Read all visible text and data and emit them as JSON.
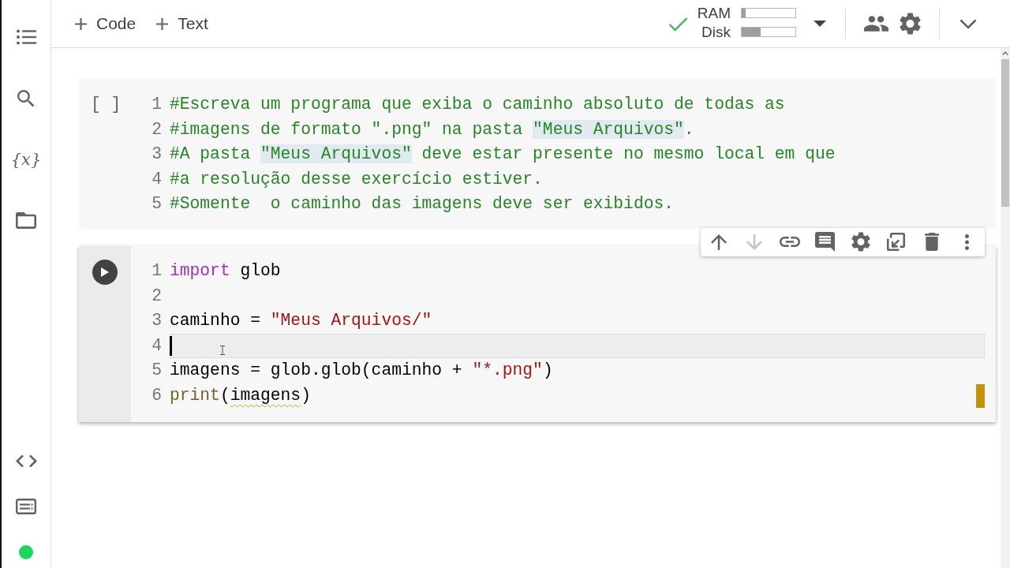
{
  "sidebar": {
    "items": [
      {
        "kind": "toc"
      },
      {
        "kind": "search"
      },
      {
        "kind": "variables",
        "glyph": "{x}"
      },
      {
        "kind": "files"
      }
    ],
    "bottom_items": [
      {
        "kind": "code_snippets"
      },
      {
        "kind": "terminal"
      },
      {
        "kind": "status_dot"
      }
    ]
  },
  "header": {
    "insert_buttons": [
      "Code",
      "Text"
    ],
    "connected": true,
    "resources": [
      {
        "label": "RAM",
        "level": 0.08
      },
      {
        "label": "Disk",
        "level": 0.35
      }
    ]
  },
  "cells": [
    {
      "focused": false,
      "execution_label": "[ ]",
      "lines": [
        {
          "number": "1",
          "current": false,
          "tokens": [
            {
              "kind": "comment",
              "text": "#Escreva um programa que exiba o caminho absoluto de todas as",
              "highlighted": false
            }
          ]
        },
        {
          "number": "2",
          "current": false,
          "tokens": [
            {
              "kind": "comment",
              "text": "#imagens de formato \".png\" na pasta ",
              "highlighted": false
            },
            {
              "kind": "comment",
              "text": "\"Meus Arquivos\"",
              "highlighted": true
            },
            {
              "kind": "comment",
              "text": ".",
              "highlighted": false
            }
          ]
        },
        {
          "number": "3",
          "current": false,
          "tokens": [
            {
              "kind": "comment",
              "text": "#A pasta ",
              "highlighted": false
            },
            {
              "kind": "comment",
              "text": "\"Meus Arquivos\"",
              "highlighted": true
            },
            {
              "kind": "comment",
              "text": " deve estar presente no mesmo local em que",
              "highlighted": false
            }
          ]
        },
        {
          "number": "4",
          "current": false,
          "tokens": [
            {
              "kind": "comment",
              "text": "#a resolução desse exercício estiver.",
              "highlighted": false
            }
          ]
        },
        {
          "number": "5",
          "current": false,
          "tokens": [
            {
              "kind": "comment",
              "text": "#Somente  o caminho das imagens deve ser exibidos.",
              "highlighted": false
            }
          ]
        }
      ]
    },
    {
      "focused": true,
      "toolbar": [
        {
          "kind": "move_up",
          "disabled": false
        },
        {
          "kind": "move_down",
          "disabled": true
        },
        {
          "kind": "link",
          "disabled": false
        },
        {
          "kind": "comment",
          "disabled": false
        },
        {
          "kind": "settings",
          "disabled": false
        },
        {
          "kind": "mirror",
          "disabled": false
        },
        {
          "kind": "delete",
          "disabled": false
        },
        {
          "kind": "more",
          "disabled": false
        }
      ],
      "lines": [
        {
          "number": "1",
          "current": false,
          "tokens": [
            {
              "kind": "keyword",
              "text": "import",
              "warning": false
            },
            {
              "kind": "plain",
              "text": " glob",
              "warning": false
            }
          ]
        },
        {
          "number": "2",
          "current": false
        },
        {
          "number": "3",
          "current": false,
          "tokens": [
            {
              "kind": "plain",
              "text": "caminho = ",
              "warning": false
            },
            {
              "kind": "string",
              "text": "\"Meus Arquivos/\"",
              "warning": false
            }
          ]
        },
        {
          "number": "4",
          "current": true
        },
        {
          "number": "5",
          "current": false,
          "tokens": [
            {
              "kind": "plain",
              "text": "imagens = glob.glob(caminho + ",
              "warning": false
            },
            {
              "kind": "string",
              "text": "\"*.png\"",
              "warning": false
            },
            {
              "kind": "plain",
              "text": ")",
              "warning": false
            }
          ]
        },
        {
          "number": "6",
          "current": false,
          "tokens": [
            {
              "kind": "builtin",
              "text": "print",
              "warning": false
            },
            {
              "kind": "plain",
              "text": "(",
              "warning": false
            },
            {
              "kind": "plain",
              "text": "imagens",
              "warning": true
            },
            {
              "kind": "plain",
              "text": ")",
              "warning": false
            }
          ]
        }
      ]
    }
  ]
}
